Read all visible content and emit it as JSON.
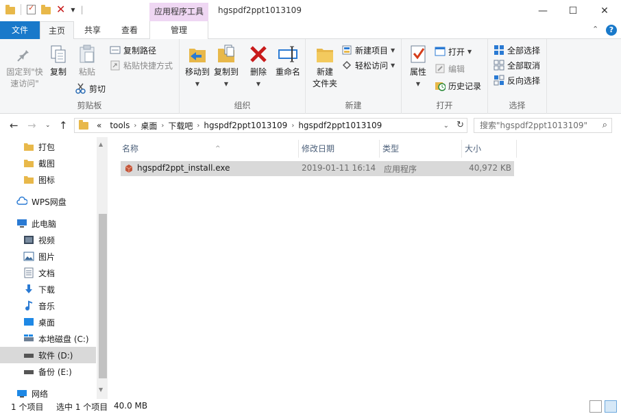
{
  "titlebar": {
    "context_tab": "应用程序工具",
    "window_title": "hgspdf2ppt1013109",
    "qat_separator": "|"
  },
  "tabs": {
    "file": "文件",
    "home": "主页",
    "share": "共享",
    "view": "查看",
    "manage": "管理"
  },
  "ribbon": {
    "clipboard": {
      "label": "剪贴板",
      "pin": "固定到\"快速访问\"",
      "copy": "复制",
      "paste": "粘贴",
      "copy_path": "复制路径",
      "paste_shortcut": "粘贴快捷方式",
      "cut": "剪切"
    },
    "organize": {
      "label": "组织",
      "move_to": "移动到",
      "copy_to": "复制到",
      "delete": "删除",
      "rename": "重命名"
    },
    "new": {
      "label": "新建",
      "new_folder_line1": "新建",
      "new_folder_line2": "文件夹",
      "new_item": "新建项目",
      "easy_access": "轻松访问"
    },
    "open": {
      "label": "打开",
      "properties": "属性",
      "open": "打开",
      "edit": "编辑",
      "history": "历史记录"
    },
    "select": {
      "label": "选择",
      "select_all": "全部选择",
      "select_none": "全部取消",
      "invert": "反向选择"
    }
  },
  "navigation": {
    "breadcrumb": [
      "tools",
      "桌面",
      "下载吧",
      "hgspdf2ppt1013109",
      "hgspdf2ppt1013109"
    ],
    "overflow": "«",
    "search_placeholder": "搜索\"hgspdf2ppt1013109\""
  },
  "navpane": {
    "items": [
      {
        "label": "打包",
        "icon": "folder-icon"
      },
      {
        "label": "截图",
        "icon": "folder-icon"
      },
      {
        "label": "图标",
        "icon": "folder-icon"
      },
      {
        "label": "WPS网盘",
        "icon": "cloud-icon"
      },
      {
        "label": "此电脑",
        "icon": "computer-icon"
      },
      {
        "label": "视频",
        "icon": "video-icon"
      },
      {
        "label": "图片",
        "icon": "pictures-icon"
      },
      {
        "label": "文档",
        "icon": "documents-icon"
      },
      {
        "label": "下载",
        "icon": "download-icon"
      },
      {
        "label": "音乐",
        "icon": "music-icon"
      },
      {
        "label": "桌面",
        "icon": "desktop-icon"
      },
      {
        "label": "本地磁盘 (C:)",
        "icon": "drive-icon"
      },
      {
        "label": "软件 (D:)",
        "icon": "drive-icon"
      },
      {
        "label": "备份 (E:)",
        "icon": "drive-icon"
      },
      {
        "label": "网络",
        "icon": "network-icon"
      }
    ]
  },
  "filelist": {
    "columns": {
      "name": "名称",
      "date": "修改日期",
      "type": "类型",
      "size": "大小"
    },
    "rows": [
      {
        "name": "hgspdf2ppt_install.exe",
        "date": "2019-01-11 16:14",
        "type": "应用程序",
        "size": "40,972 KB"
      }
    ]
  },
  "statusbar": {
    "item_count": "1 个项目",
    "selected": "选中 1 个项目",
    "size": "40.0 MB"
  },
  "colors": {
    "accent": "#1979ca",
    "context_tab": "#efd7f3",
    "folder": "#e8b84a",
    "selection": "#d9d9d9"
  }
}
